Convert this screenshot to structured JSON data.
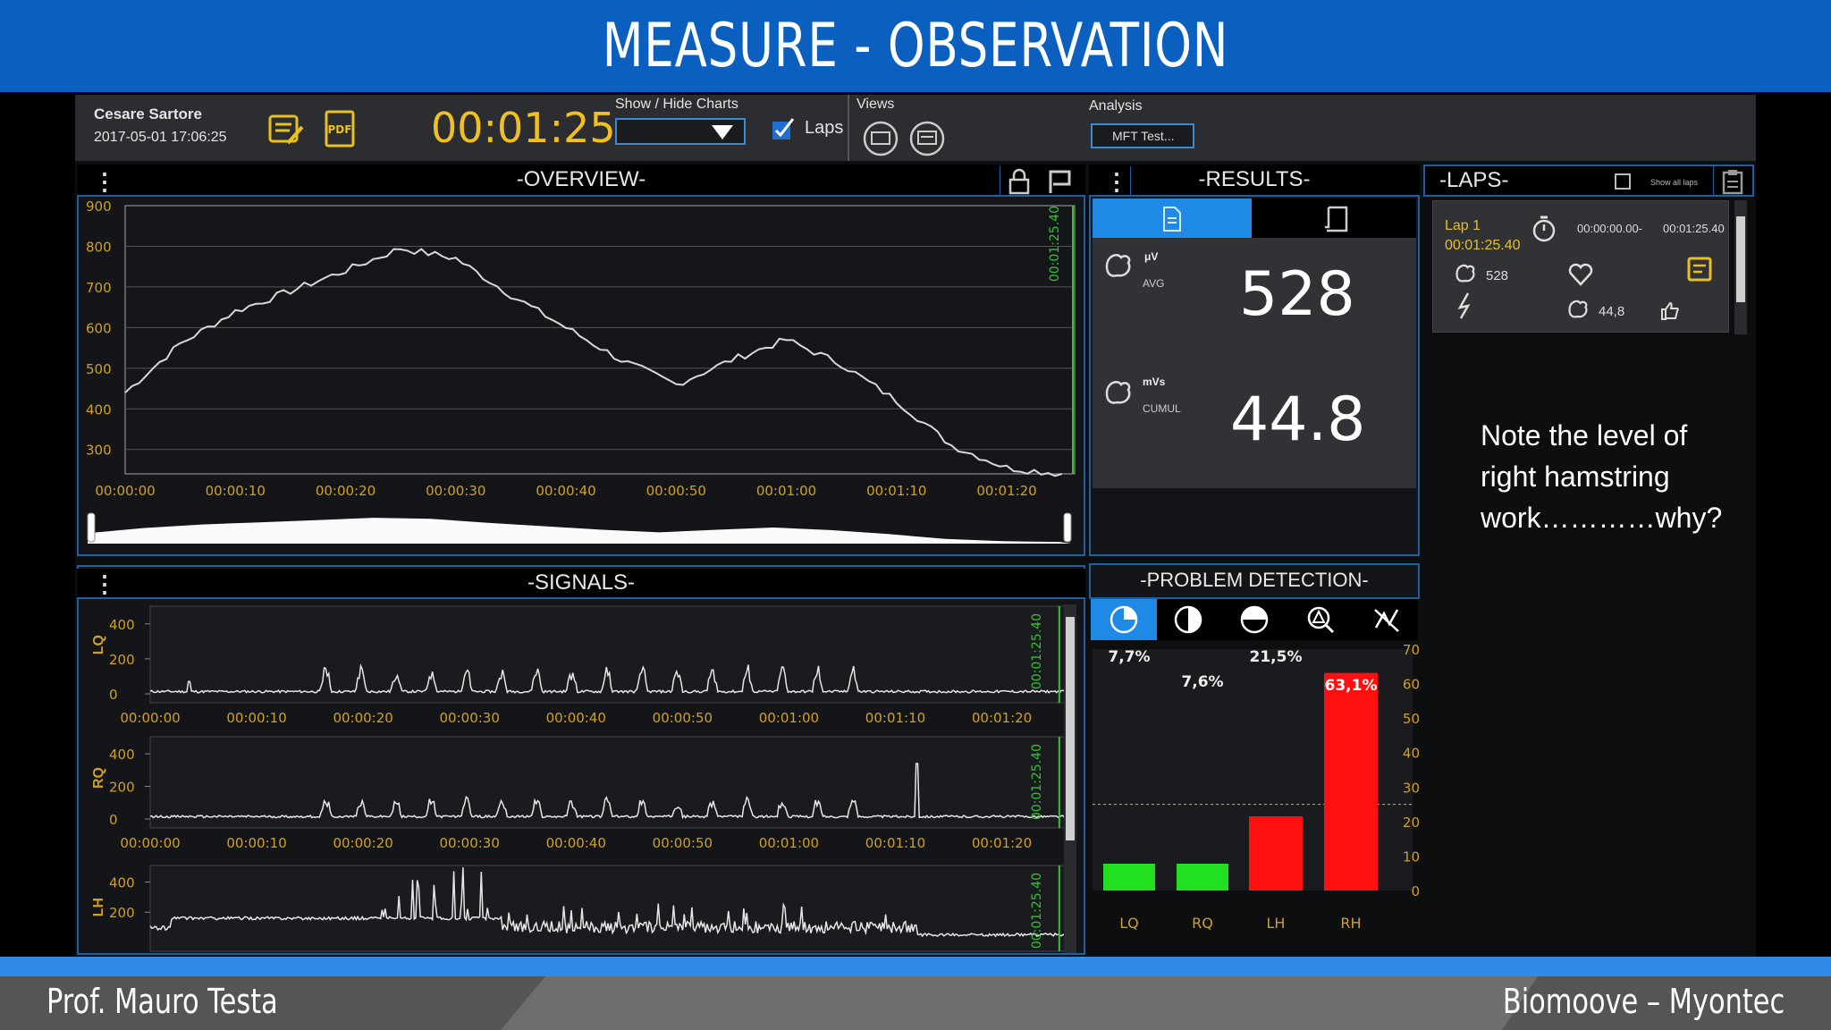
{
  "slide": {
    "title": "MEASURE - OBSERVATION",
    "note": "Note the level of right hamstring work…………why?",
    "footer_left": "Prof. Mauro Testa",
    "footer_right": "Biomoove – Myontec"
  },
  "toolbar": {
    "user_name": "Cesare Sartore",
    "datetime": "2017-05-01 17:06:25",
    "timer": "00:01:25",
    "show_hide_label": "Show / Hide Charts",
    "laps_label": "Laps",
    "laps_checked": true,
    "views_label": "Views",
    "analysis_label": "Analysis",
    "analysis_value": "MFT Test..."
  },
  "overview": {
    "title": "-OVERVIEW-",
    "marker_label": "00:01:25.40",
    "y_ticks": [
      "900",
      "800",
      "700",
      "600",
      "500",
      "400",
      "300"
    ],
    "x_ticks": [
      "00:00:00",
      "00:00:10",
      "00:00:20",
      "00:00:30",
      "00:00:40",
      "00:00:50",
      "00:01:00",
      "00:01:10",
      "00:01:20"
    ]
  },
  "signals": {
    "title": "-SIGNALS-",
    "marker_label": "00:01:25.40",
    "channels": [
      {
        "name": "LQ",
        "y_ticks": [
          "400",
          "200",
          "0"
        ]
      },
      {
        "name": "RQ",
        "y_ticks": [
          "400",
          "200",
          "0"
        ]
      },
      {
        "name": "LH",
        "y_ticks": [
          "400",
          "200"
        ]
      }
    ],
    "x_ticks": [
      "00:00:00",
      "00:00:10",
      "00:00:20",
      "00:00:30",
      "00:00:40",
      "00:00:50",
      "00:01:00",
      "00:01:10",
      "00:01:20"
    ]
  },
  "results": {
    "title": "-RESULTS-",
    "avg_unit": "μV",
    "avg_label": "AVG",
    "avg_value": "528",
    "cumul_unit": "mVs",
    "cumul_label": "CUMUL",
    "cumul_value": "44.8"
  },
  "laps": {
    "title": "-LAPS-",
    "show_all_label": "Show all laps",
    "lap_name": "Lap 1",
    "lap_duration": "00:01:25.40",
    "lap_start": "00:00:00.00-",
    "lap_end": "00:01:25.40",
    "lap_avg": "528",
    "lap_cumul": "44,8"
  },
  "problem_detection": {
    "title": "-PROBLEM DETECTION-",
    "y_ticks": [
      "70",
      "60",
      "50",
      "40",
      "30",
      "20",
      "10",
      "0"
    ],
    "labels": [
      "7,7%",
      "7,6%",
      "21,5%",
      "63,1%"
    ]
  },
  "chart_data": [
    {
      "type": "line",
      "title": "-OVERVIEW-",
      "x": [
        "00:00:00",
        "00:00:05",
        "00:00:10",
        "00:00:15",
        "00:00:20",
        "00:00:25",
        "00:00:30",
        "00:00:35",
        "00:00:40",
        "00:00:45",
        "00:00:50",
        "00:00:55",
        "00:01:00",
        "00:01:05",
        "00:01:10",
        "00:01:15",
        "00:01:20",
        "00:01:25"
      ],
      "x_seconds": [
        0,
        5,
        10,
        15,
        20,
        25,
        30,
        35,
        40,
        45,
        50,
        55,
        60,
        65,
        70,
        75,
        80,
        85
      ],
      "values": [
        440,
        560,
        640,
        690,
        740,
        795,
        770,
        680,
        600,
        520,
        460,
        520,
        570,
        510,
        420,
        310,
        255,
        240
      ],
      "ylim": [
        240,
        900
      ],
      "xlim_seconds": [
        0,
        86
      ]
    },
    {
      "type": "bar",
      "title": "-PROBLEM DETECTION-",
      "categories": [
        "LQ",
        "RQ",
        "LH",
        "RH"
      ],
      "values": [
        7.7,
        7.6,
        21.5,
        63.1
      ],
      "colors": [
        "#20e020",
        "#20e020",
        "#ff1010",
        "#ff1010"
      ],
      "ylim": [
        0,
        70
      ],
      "threshold": 25
    }
  ]
}
